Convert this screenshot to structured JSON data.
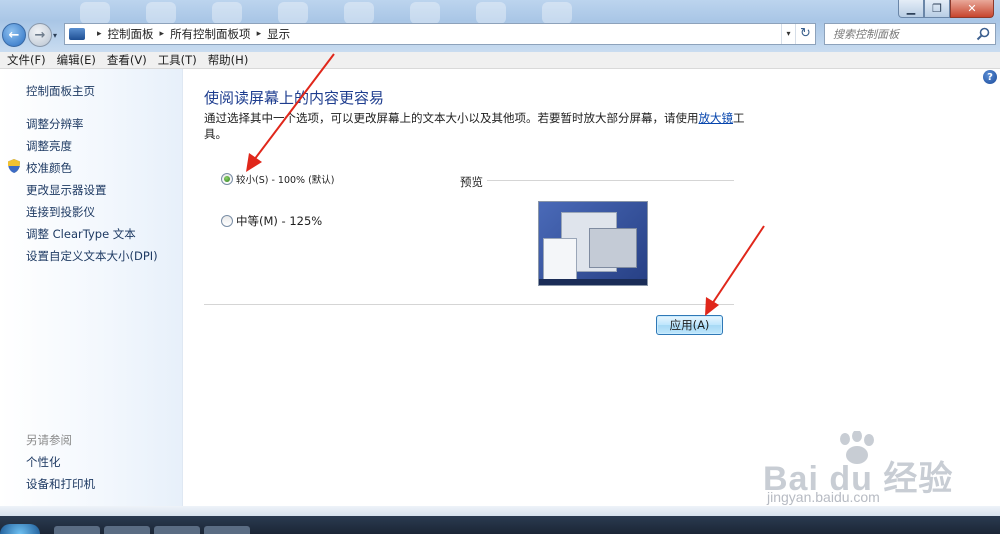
{
  "window": {
    "minimize_glyph": "▁",
    "maximize_glyph": "❐",
    "close_glyph": "✕"
  },
  "navigation": {
    "back_glyph": "←",
    "forward_glyph": "→",
    "history_dropdown_glyph": "▾"
  },
  "address_bar": {
    "breadcrumbs": [
      "控制面板",
      "所有控制面板项",
      "显示"
    ],
    "separator": "▸",
    "dropdown_glyph": "▾",
    "refresh_glyph": "↻"
  },
  "search": {
    "placeholder": "搜索控制面板"
  },
  "menu": {
    "items": [
      "文件(F)",
      "编辑(E)",
      "查看(V)",
      "工具(T)",
      "帮助(H)"
    ]
  },
  "left_nav": {
    "home": "控制面板主页",
    "links": [
      "调整分辨率",
      "调整亮度",
      "校准颜色",
      "更改显示器设置",
      "连接到投影仪",
      "调整 ClearType 文本",
      "设置自定义文本大小(DPI)"
    ],
    "see_also_heading": "另请参阅",
    "see_also": [
      "个性化",
      "设备和打印机"
    ]
  },
  "help_glyph": "?",
  "content": {
    "title": "使阅读屏幕上的内容更容易",
    "description_before_link": "通过选择其中一个选项，可以更改屏幕上的文本大小以及其他项。若要暂时放大部分屏幕，请使用",
    "magnifier_link": "放大镜",
    "description_after_link": "工具。",
    "options": [
      {
        "label": "较小(S) - 100% (默认)",
        "selected": true
      },
      {
        "label": "中等(M) - 125%",
        "selected": false
      }
    ],
    "preview_label": "预览",
    "apply_button": "应用(A)"
  },
  "colors": {
    "title_blue": "#1e3d8f",
    "link_blue": "#0645ad",
    "annotation_red": "#e0271b"
  },
  "watermark": {
    "brand": "Bai du 经验",
    "url": "jingyan.baidu.com"
  }
}
